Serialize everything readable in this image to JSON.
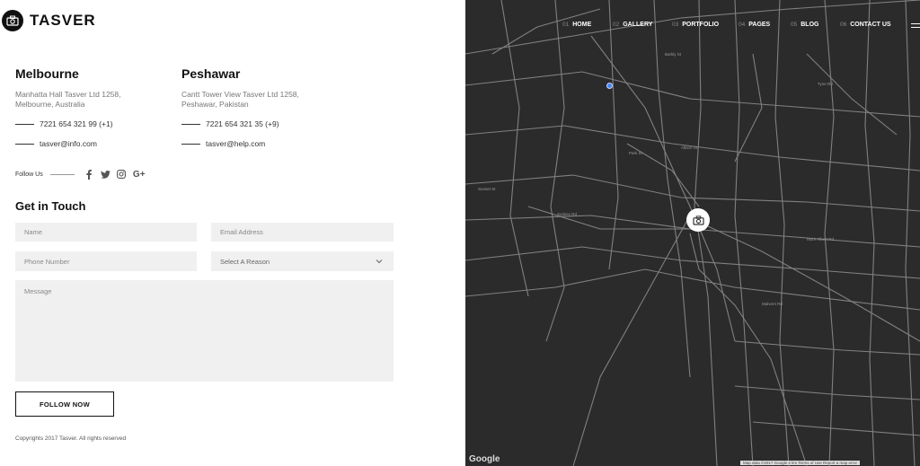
{
  "brand": {
    "name": "TASVER"
  },
  "offices": [
    {
      "city": "Melbourne",
      "address_line1": "Manhatta Hall Tasver Ltd 1258,",
      "address_line2": "Melbourne, Australia",
      "phone": "7221 654 321 99 (+1)",
      "email": "tasver@info.com"
    },
    {
      "city": "Peshawar",
      "address_line1": "Cantt Tower View Tasver Ltd 1258,",
      "address_line2": "Peshawar, Pakistan",
      "phone": "7221 654 321 35 (+9)",
      "email": "tasver@help.com"
    }
  ],
  "follow": {
    "label": "Follow Us",
    "icons": [
      "facebook-icon",
      "twitter-icon",
      "instagram-icon",
      "google-plus-icon"
    ]
  },
  "form": {
    "title": "Get in Touch",
    "name_placeholder": "Name",
    "email_placeholder": "Email Address",
    "phone_placeholder": "Phone Number",
    "reason_value": "Select A Reason",
    "message_placeholder": "Message",
    "submit_label": "FOLLOW NOW"
  },
  "copyright": "Copyrights 2017 Tasver. All rights reserved",
  "nav": [
    {
      "num": "01",
      "label": "HOME"
    },
    {
      "num": "02",
      "label": "GALLERY"
    },
    {
      "num": "03",
      "label": "PORTFOLIO"
    },
    {
      "num": "04",
      "label": "PAGES"
    },
    {
      "num": "05",
      "label": "BLOG"
    },
    {
      "num": "06",
      "label": "CONTACT US"
    }
  ],
  "map": {
    "google_label": "Google",
    "attribution": "Map data ©2017 Google   2 km   Terms of Use   Report a map error",
    "background": "#2b2b2b",
    "road_color": "#8a8a8a",
    "marker_color": "#4285f4"
  }
}
